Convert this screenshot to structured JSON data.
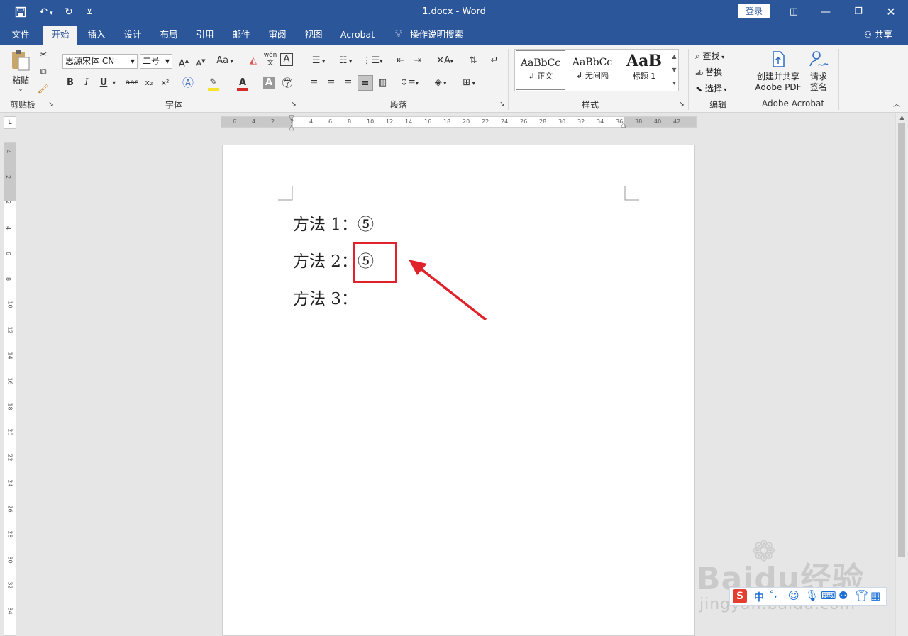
{
  "window": {
    "title": "1.docx  -  Word",
    "login_label": "登录",
    "share_label": "共享"
  },
  "tabs": [
    "文件",
    "开始",
    "插入",
    "设计",
    "布局",
    "引用",
    "邮件",
    "审阅",
    "视图",
    "Acrobat"
  ],
  "tell_me": "操作说明搜索",
  "ribbon": {
    "clipboard": {
      "paste_label": "粘贴",
      "group_label": "剪贴板"
    },
    "font": {
      "font_name": "思源宋体 CN",
      "font_size": "二号",
      "group_label": "字体",
      "change_case": "Aa",
      "pinyin": "wén",
      "border_char": "A",
      "bold": "B",
      "italic": "I",
      "underline": "U",
      "strike": "abc",
      "sub": "x₂",
      "sup": "x²",
      "highlight_color": "#f5e42b",
      "font_color": "#d42a2a"
    },
    "paragraph": {
      "group_label": "段落"
    },
    "styles": {
      "group_label": "样式",
      "items": [
        {
          "preview": "AaBbCc",
          "name": "↲ 正文"
        },
        {
          "preview": "AaBbCc",
          "name": "↲ 无间隔"
        },
        {
          "preview": "AaB",
          "name": "标题 1"
        }
      ]
    },
    "editing": {
      "group_label": "编辑",
      "find": "查找",
      "replace": "替换",
      "select": "选择"
    },
    "acrobat": {
      "group_label": "Adobe Acrobat",
      "create_line1": "创建并共享",
      "create_line2": "Adobe PDF",
      "request_line1": "请求",
      "request_line2": "签名"
    }
  },
  "ruler": {
    "horizontal": [
      "6",
      "4",
      "2",
      "2",
      "4",
      "6",
      "8",
      "10",
      "12",
      "14",
      "16",
      "18",
      "20",
      "22",
      "24",
      "26",
      "28",
      "30",
      "32",
      "34",
      "36",
      "38",
      "40",
      "42"
    ],
    "vertical": [
      "4",
      "2",
      "2",
      "4",
      "6",
      "8",
      "10",
      "12",
      "14",
      "16",
      "18",
      "20",
      "22",
      "24",
      "26",
      "28",
      "30",
      "32",
      "34"
    ]
  },
  "document": {
    "lines": [
      "方法 1：⑤",
      "方法 2：⑤",
      "方法 3："
    ]
  },
  "annotation": {
    "color": "#e0232a"
  },
  "watermark": {
    "text": "Baidu经验",
    "url": "jingyan.baidu.com"
  },
  "ime": {
    "mode": "中",
    "punct": "°,"
  }
}
